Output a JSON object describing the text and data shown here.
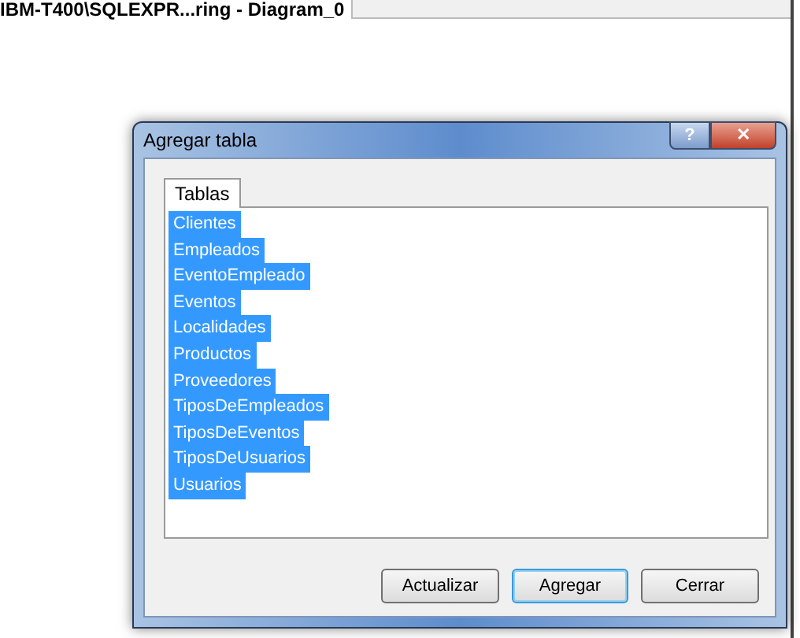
{
  "document_tab": {
    "title": "IBM-T400\\SQLEXPR...ring - Diagram_0"
  },
  "dialog": {
    "title": "Agregar tabla",
    "help": "?",
    "close": "✕",
    "tabs": [
      {
        "label": "Tablas",
        "selected": true
      }
    ],
    "items": [
      {
        "label": "Clientes",
        "selected": true
      },
      {
        "label": "Empleados",
        "selected": true
      },
      {
        "label": "EventoEmpleado",
        "selected": true
      },
      {
        "label": "Eventos",
        "selected": true
      },
      {
        "label": "Localidades",
        "selected": true
      },
      {
        "label": "Productos",
        "selected": true
      },
      {
        "label": "Proveedores",
        "selected": true
      },
      {
        "label": "TiposDeEmpleados",
        "selected": true
      },
      {
        "label": "TiposDeEventos",
        "selected": true
      },
      {
        "label": "TiposDeUsuarios",
        "selected": true
      },
      {
        "label": "Usuarios",
        "selected": true
      }
    ],
    "buttons": [
      {
        "label": "Actualizar",
        "default": false
      },
      {
        "label": "Agregar",
        "default": true
      },
      {
        "label": "Cerrar",
        "default": false
      }
    ]
  }
}
